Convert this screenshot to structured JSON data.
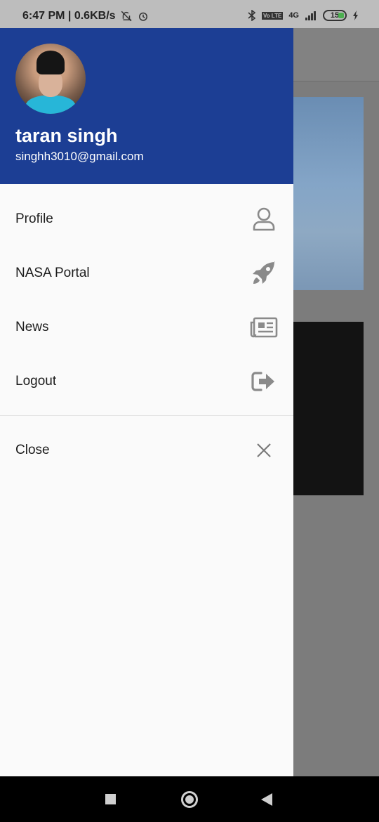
{
  "status_bar": {
    "time_text": "6:47 PM | 0.6KB/s",
    "network_label": "4G",
    "volte_label": "Vo LTE",
    "battery_level": "15"
  },
  "drawer": {
    "user": {
      "name": "taran singh",
      "email": "singhh3010@gmail.com"
    },
    "items": [
      {
        "label": "Profile",
        "icon": "user-icon"
      },
      {
        "label": "NASA Portal",
        "icon": "rocket-icon"
      },
      {
        "label": "News",
        "icon": "newspaper-icon"
      },
      {
        "label": "Logout",
        "icon": "logout-icon"
      }
    ],
    "close": {
      "label": "Close",
      "icon": "close-icon"
    }
  },
  "colors": {
    "header_bg": "#1c3e94",
    "drawer_bg": "#fafafa",
    "icon_gray": "#8a8a8a"
  }
}
